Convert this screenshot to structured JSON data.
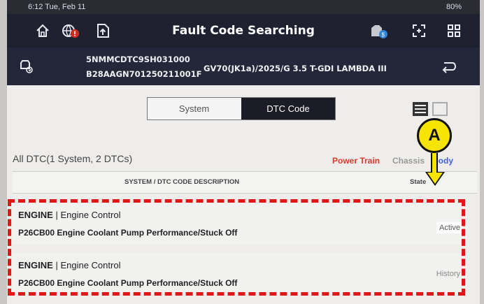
{
  "status_bar": {
    "time": "6:12  Tue, Feb 11",
    "battery": "80%"
  },
  "header": {
    "title": "Fault Code Searching"
  },
  "vehicle": {
    "vin": "5NMMCDTC9SH031000",
    "code": "B28AAGN701250211001F",
    "model": "GV70(JK1a)/2025/G 3.5 T-GDI LAMBDA III"
  },
  "tabs": [
    {
      "label": "System",
      "selected": false
    },
    {
      "label": "DTC Code",
      "selected": true
    }
  ],
  "summary": "All DTC(1 System, 2 DTCs)",
  "categories": [
    {
      "label": "Power Train",
      "color": "#d63a2a"
    },
    {
      "label": "Chassis",
      "color": "#999999"
    },
    {
      "label": "Body",
      "color": "#3f63d8"
    }
  ],
  "table": {
    "headers": [
      "SYSTEM / DTC CODE DESCRIPTION",
      "State"
    ],
    "rows": [
      {
        "system": "ENGINE",
        "subsystem": "Engine Control",
        "code": "P26CB00",
        "description": "Engine Coolant Pump Performance/Stuck Off",
        "state": "Active"
      },
      {
        "system": "ENGINE",
        "subsystem": "Engine Control",
        "code": "P26CB00",
        "description": "Engine Coolant Pump Performance/Stuck Off",
        "state": "History"
      }
    ]
  },
  "callout": {
    "label": "A",
    "color": "#f7e400"
  },
  "highlight_color": "#e01717"
}
